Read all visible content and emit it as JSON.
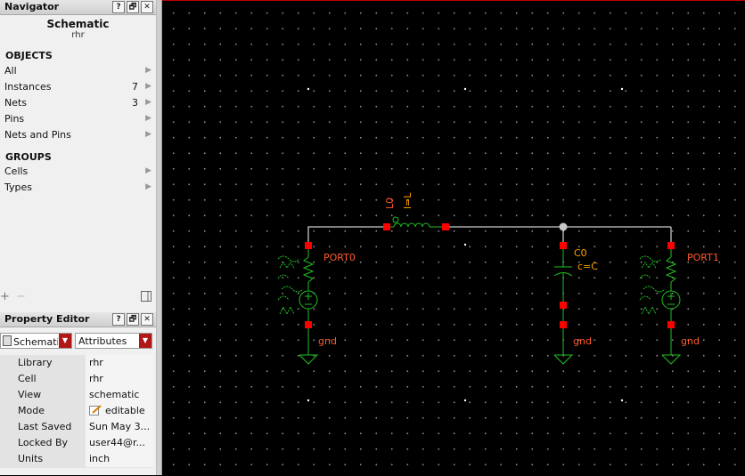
{
  "navigator": {
    "title": "Navigator",
    "heading": "Schematic",
    "subheading": "rhr",
    "objects_label": "OBJECTS",
    "objects": [
      {
        "label": "All",
        "count": ""
      },
      {
        "label": "Instances",
        "count": "7"
      },
      {
        "label": "Nets",
        "count": "3"
      },
      {
        "label": "Pins",
        "count": ""
      },
      {
        "label": "Nets and Pins",
        "count": ""
      }
    ],
    "groups_label": "GROUPS",
    "groups": [
      {
        "label": "Cells"
      },
      {
        "label": "Types"
      }
    ],
    "footer_add": "+",
    "footer_remove": "−"
  },
  "window_buttons": {
    "help": "?",
    "float": "🗗",
    "close": "✕"
  },
  "property_editor": {
    "title": "Property Editor",
    "object_select": "Schematic",
    "category_select": "Attributes",
    "rows": [
      {
        "key": "Library",
        "value": "rhr"
      },
      {
        "key": "Cell",
        "value": "rhr"
      },
      {
        "key": "View",
        "value": "schematic"
      },
      {
        "key": "Mode",
        "value": "editable"
      },
      {
        "key": "Last Saved",
        "value": "Sun May 3..."
      },
      {
        "key": "Locked By",
        "value": "user44@r..."
      },
      {
        "key": "Units",
        "value": "inch"
      }
    ]
  },
  "schematic": {
    "port0_label": "PORT0",
    "port1_label": "PORT1",
    "cap_name": "C0",
    "cap_value": "c=C",
    "ind_name": "L0",
    "ind_value": "l=L",
    "gnd_label": "gnd",
    "colors": {
      "wire": "#ffffff",
      "component": "#20c020",
      "pin": "#ff0000",
      "label": "#ff5a2a",
      "cap_label": "#ffa000"
    }
  }
}
